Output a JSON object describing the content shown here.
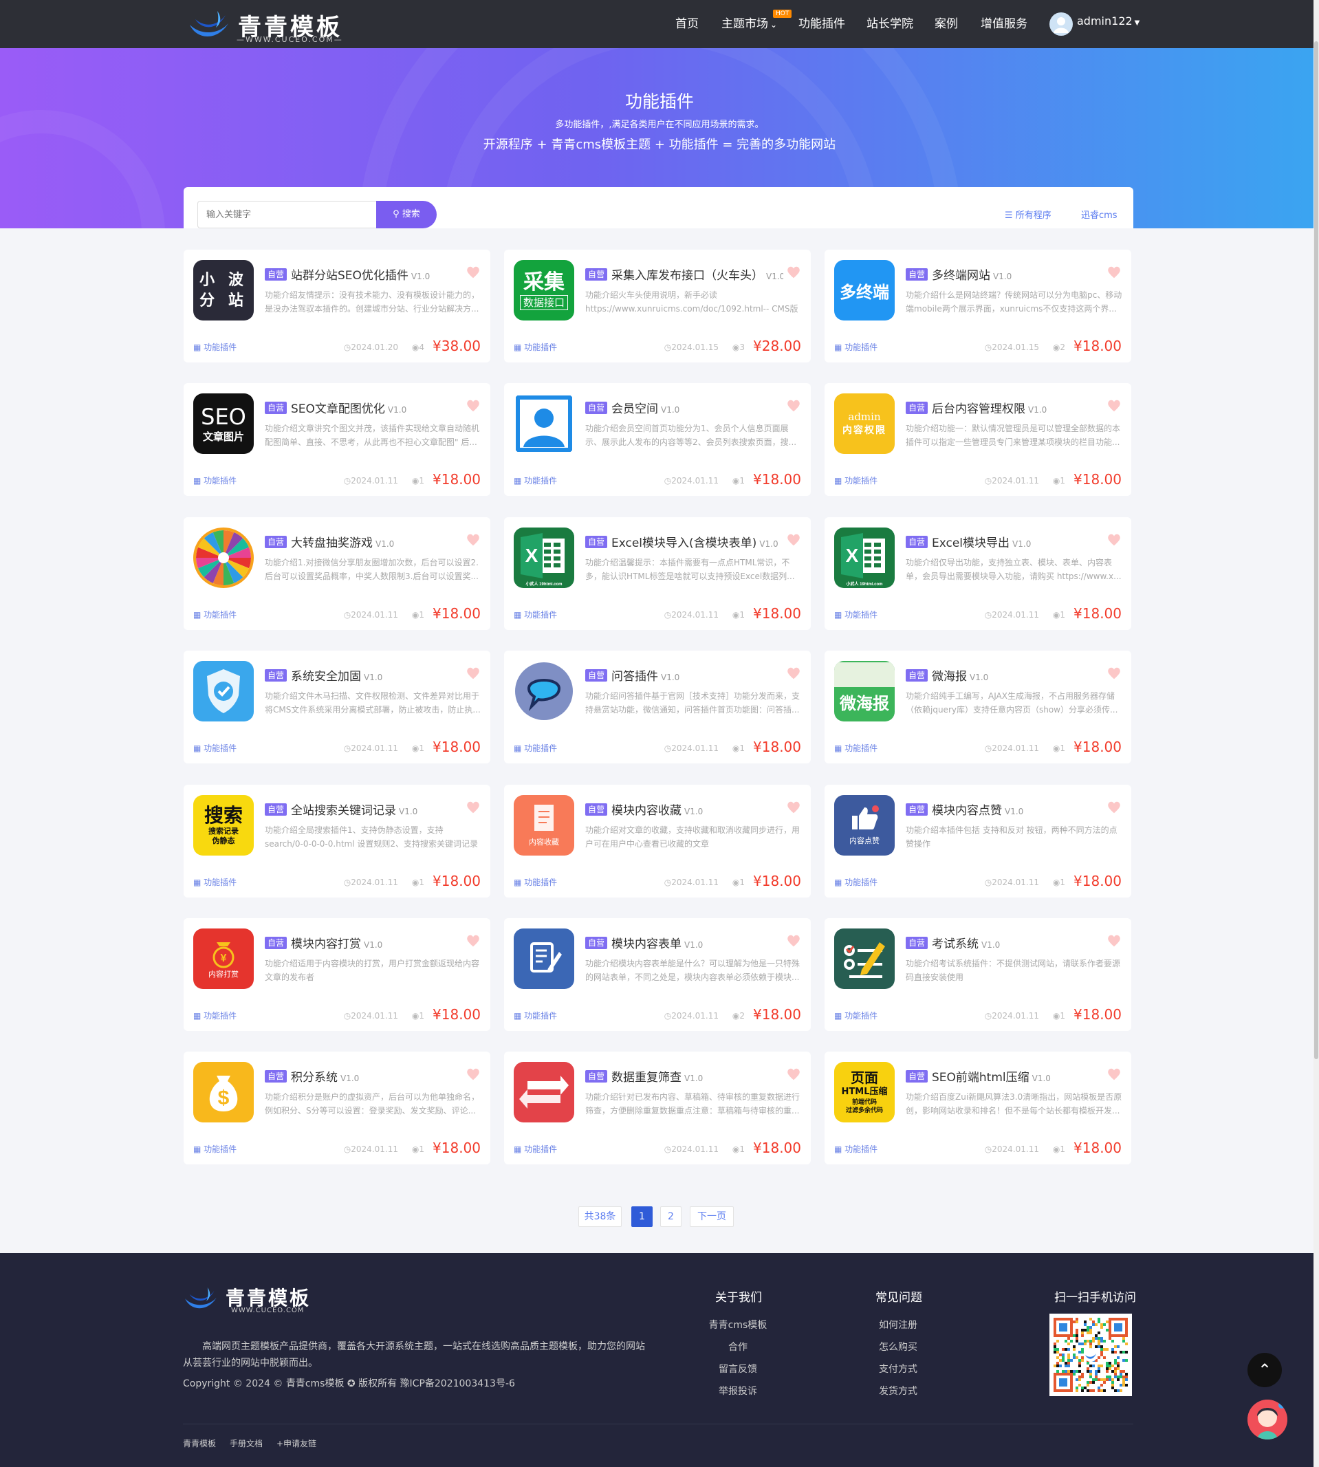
{
  "header": {
    "logo_text": "青青模板",
    "logo_url": "—WWW.CUCEO.COM—",
    "nav": [
      "首页",
      "主题市场",
      "功能插件",
      "站长学院",
      "案例",
      "增值服务"
    ],
    "hot_badge": "HOT",
    "user": "admin122"
  },
  "banner": {
    "title": "功能插件",
    "subtitle": "多功能插件，,满足各类用户在不同应用场景的需求。",
    "tagline": "开源程序 + 青青cms模板主题 + 功能插件 = 完善的多功能网站"
  },
  "search": {
    "placeholder": "输入关键字",
    "button": "搜索",
    "filter_all": "所有程序",
    "filter_cms": "迅睿cms"
  },
  "products": [
    {
      "name": "站群分站SEO优化插件",
      "version": "V1.0",
      "tag": "自营",
      "desc": "功能介绍友情提示：没有技术能力、没有模板设计能力的，是没办法驾驭本插件的。创建城市分站、行业分站解决方...",
      "category": "功能插件",
      "date": "2024.01.20",
      "views": "4",
      "price": "¥38.00",
      "icon": "小波分站",
      "icon_text": [
        "小 波",
        "分 站"
      ],
      "icon_bg": "#2a2a38",
      "icon_fg": "#ffffff"
    },
    {
      "name": "采集入库发布接口（火车头）",
      "version": "V1.0",
      "tag": "自营",
      "desc": "功能介绍火车头使用说明，新手必读 https://www.xunruicms.com/doc/1092.html-- CMS版本说明1、支持迅...",
      "category": "功能插件",
      "date": "2024.01.15",
      "views": "3",
      "price": "¥28.00",
      "icon": "采集数据接口",
      "icon_text": [
        "采集",
        "数据接口"
      ],
      "icon_bg": "#13a33d",
      "icon_fg": "#ffffff"
    },
    {
      "name": "多终端网站",
      "version": "V1.0",
      "tag": "自营",
      "desc": "功能介绍什么是网站终端？传统网站可以分为电脑pc、移动端mobile两个展示界面，xunruicms不仅支持这两个界...",
      "category": "功能插件",
      "date": "2024.01.15",
      "views": "2",
      "price": "¥18.00",
      "icon": "多终端",
      "icon_text": [
        "多终端"
      ],
      "icon_bg": "#2196f3",
      "icon_fg": "#ffffff"
    },
    {
      "name": "SEO文章配图优化",
      "version": "V1.0",
      "tag": "自营",
      "desc": "功能介绍文章讲究个图文并茂，该插件实现给文章自动随机配图简单、直接、不思考，从此再也不担心文章配图\" 后...",
      "category": "功能插件",
      "date": "2024.01.11",
      "views": "1",
      "price": "¥18.00",
      "icon": "SEO文章图片",
      "icon_text": [
        "SEO",
        "文章图片"
      ],
      "icon_bg": "#111111",
      "icon_fg": "#ffffff"
    },
    {
      "name": "会员空间",
      "version": "V1.0",
      "tag": "自营",
      "desc": "功能介绍会员空间首页功能分为1、会员个人信息页面展示、展示此人发布的内容等等2、会员列表搜索页面，搜...",
      "category": "功能插件",
      "date": "2024.01.11",
      "views": "1",
      "price": "¥18.00",
      "icon": "user-icon",
      "icon_text": [],
      "icon_bg": "#ffffff",
      "icon_fg": "#1e8be6"
    },
    {
      "name": "后台内容管理权限",
      "version": "V1.0",
      "tag": "自营",
      "desc": "功能介绍功能一：默认情况管理员是可以管理全部数据的本插件可以指定一些管理员专门来管理某项模块的栏目功能...",
      "category": "功能插件",
      "date": "2024.01.11",
      "views": "1",
      "price": "¥18.00",
      "icon": "admin内容权限",
      "icon_text": [
        "admin",
        "内容权限"
      ],
      "icon_bg": "#f7c21c",
      "icon_fg": "#ffffff"
    },
    {
      "name": "大转盘抽奖游戏",
      "version": "V1.0",
      "tag": "自营",
      "desc": "功能介绍1.对接微信分享朋友圈增加次数，后台可以设置2.后台可以设置奖品概率，中奖人数限制3.后台可以设置奖...",
      "category": "功能插件",
      "date": "2024.01.11",
      "views": "1",
      "price": "¥18.00",
      "icon": "wheel-icon",
      "icon_text": [],
      "icon_bg": "#ffffff",
      "icon_fg": "#ffffff"
    },
    {
      "name": "Excel模块导入(含模块表单)",
      "version": "V1.0",
      "tag": "自营",
      "desc": "功能介绍温馨提示：本插件需要有一点点HTML常识，不多，能认识HTML标签是啥就可以支持预设Excel数据列...",
      "category": "功能插件",
      "date": "2024.01.11",
      "views": "1",
      "price": "¥18.00",
      "icon": "excel-icon",
      "icon_text": [
        "X",
        "小武人 19html.com"
      ],
      "icon_bg": "#1a7b40",
      "icon_fg": "#ffffff"
    },
    {
      "name": "Excel模块导出",
      "version": "V1.0",
      "tag": "自营",
      "desc": "功能介绍仅导出功能，支持独立表、模块、表单、内容表单，会员导出需要模块导入功能，请购买 https://www.x...",
      "category": "功能插件",
      "date": "2024.01.11",
      "views": "1",
      "price": "¥18.00",
      "icon": "excel-icon",
      "icon_text": [
        "X",
        "小武人 19html.com"
      ],
      "icon_bg": "#1a7b40",
      "icon_fg": "#ffffff"
    },
    {
      "name": "系统安全加固",
      "version": "V1.0",
      "tag": "自营",
      "desc": "功能介绍文件木马扫描、文件权限检测、文件差异对比用于将CMS文件系统采用分离模式部署，防止被攻击，防止执...",
      "category": "功能插件",
      "date": "2024.01.11",
      "views": "1",
      "price": "¥18.00",
      "icon": "shield-icon",
      "icon_text": [],
      "icon_bg": "#3aa7ec",
      "icon_fg": "#ffffff"
    },
    {
      "name": "问答插件",
      "version": "V1.0",
      "tag": "自营",
      "desc": "功能介绍问答插件基于官网［技术支持］功能分发而来，支持悬赏站功能，微信通知，问答插件首页功能图：问答插...",
      "category": "功能插件",
      "date": "2024.01.11",
      "views": "1",
      "price": "¥18.00",
      "icon": "chat-icon",
      "icon_text": [],
      "icon_bg": "#ffffff",
      "icon_fg": "#2e4a8c"
    },
    {
      "name": "微海报",
      "version": "V1.0",
      "tag": "自营",
      "desc": "功能介绍纯手工编写，AJAX生成海报，不占用服务器存储（依赖jquery库）支持任意内容页（show）分享必须传...",
      "category": "功能插件",
      "date": "2024.01.11",
      "views": "1",
      "price": "¥18.00",
      "icon": "微海报",
      "icon_text": [
        "微海报"
      ],
      "icon_bg": "#3cb55a",
      "icon_fg": "#ffffff"
    },
    {
      "name": "全站搜索关键词记录",
      "version": "V1.0",
      "tag": "自营",
      "desc": "功能介绍全局搜索插件1、支持伪静态设置，支持 search/0-0-0-0-0.html 设置规则2、支持搜索关键词记录（分...",
      "category": "功能插件",
      "date": "2024.01.11",
      "views": "1",
      "price": "¥18.00",
      "icon": "搜索记录伪静态",
      "icon_text": [
        "搜索",
        "搜索记录",
        "伪静态"
      ],
      "icon_bg": "#f8d90f",
      "icon_fg": "#111111"
    },
    {
      "name": "模块内容收藏",
      "version": "V1.0",
      "tag": "自营",
      "desc": "功能介绍对文章的收藏，支持收藏和取消收藏同步进行，用户可在用户中心查看已收藏的文章",
      "category": "功能插件",
      "date": "2024.01.11",
      "views": "1",
      "price": "¥18.00",
      "icon": "内容收藏",
      "icon_text": [
        "内容收藏"
      ],
      "icon_bg": "#f87a58",
      "icon_fg": "#ffffff"
    },
    {
      "name": "模块内容点赞",
      "version": "V1.0",
      "tag": "自营",
      "desc": "功能介绍本插件包括 支持和反对 按钮，两种不同方法的点赞操作",
      "category": "功能插件",
      "date": "2024.01.11",
      "views": "1",
      "price": "¥18.00",
      "icon": "内容点赞",
      "icon_text": [
        "内容点赞"
      ],
      "icon_bg": "#3d5a9e",
      "icon_fg": "#ffffff"
    },
    {
      "name": "模块内容打赏",
      "version": "V1.0",
      "tag": "自营",
      "desc": "功能介绍适用于内容模块的打赏，用户打赏金额返现给内容文章的发布者",
      "category": "功能插件",
      "date": "2024.01.11",
      "views": "1",
      "price": "¥18.00",
      "icon": "内容打赏",
      "icon_text": [
        "¥",
        "内容打赏"
      ],
      "icon_bg": "#e5342d",
      "icon_fg": "#ffffff"
    },
    {
      "name": "模块内容表单",
      "version": "V1.0",
      "tag": "自营",
      "desc": "功能介绍模块内容表单能是什么？可以理解为他是一只特殊的网站表单，不同之处是，模块内容表单必须依赖于模块...",
      "category": "功能插件",
      "date": "2024.01.11",
      "views": "2",
      "price": "¥18.00",
      "icon": "form-icon",
      "icon_text": [],
      "icon_bg": "#3b67b5",
      "icon_fg": "#ffffff"
    },
    {
      "name": "考试系统",
      "version": "V1.0",
      "tag": "自营",
      "desc": "功能介绍考试系统插件：不提供测试网站，请联系作者要源码直接安装使用",
      "category": "功能插件",
      "date": "2024.01.11",
      "views": "1",
      "price": "¥18.00",
      "icon": "exam-icon",
      "icon_text": [],
      "icon_bg": "#275e52",
      "icon_fg": "#ffffff"
    },
    {
      "name": "积分系统",
      "version": "V1.0",
      "tag": "自营",
      "desc": "功能介绍积分是账户的虚拟资产，后台可以为他单独命名，例如积分、S分等可以设置：登录奖励、发文奖励、评论...",
      "category": "功能插件",
      "date": "2024.01.11",
      "views": "1",
      "price": "¥18.00",
      "icon": "moneybag-icon",
      "icon_text": [
        "$"
      ],
      "icon_bg": "#f8b81c",
      "icon_fg": "#ffffff"
    },
    {
      "name": "数据重复筛查",
      "version": "V1.0",
      "tag": "自营",
      "desc": "功能介绍针对已发布内容、草稿箱、待审核的重复数据进行筛查，方便删除重复数据重点注意：草稿箱与待审核的重...",
      "category": "功能插件",
      "date": "2024.01.11",
      "views": "1",
      "price": "¥18.00",
      "icon": "refresh-icon",
      "icon_text": [],
      "icon_bg": "#e34349",
      "icon_fg": "#ffffff"
    },
    {
      "name": "SEO前端html压缩",
      "version": "V1.0",
      "tag": "自营",
      "desc": "功能介绍百度Zui新飓风算法3.0清晰指出，网站模板是否原创，影响网站收录和排名！但不是每个站长都有模板开发...",
      "category": "功能插件",
      "date": "2024.01.11",
      "views": "1",
      "price": "¥18.00",
      "icon": "页面HTML压缩",
      "icon_text": [
        "页面",
        "HTML压缩",
        "前端代码",
        "过滤多余代码"
      ],
      "icon_bg": "#f8d10f",
      "icon_fg": "#111111"
    }
  ],
  "pagination": {
    "total": "共38条",
    "pages": [
      "1",
      "2"
    ],
    "next": "下一页",
    "current": "1"
  },
  "footer": {
    "logo_text": "青青模板",
    "logo_url": "WWW.CUCEO.COM",
    "about": "高端网页主题模板产品提供商，覆盖各大开源系统主题，一站式在线选购高品质主题模板，助力您的网站从芸芸行业的网站中脱颖而出。",
    "copyright": "Copyright © 2024 © 青青cms模板 ✪ 版权所有 豫ICP备2021003413号-6",
    "col1_title": "关于我们",
    "col1": [
      "青青cms模板",
      "合作",
      "留言反馈",
      "举报投诉"
    ],
    "col2_title": "常见问题",
    "col2": [
      "如何注册",
      "怎么购买",
      "支付方式",
      "发货方式"
    ],
    "qr_title": "扫一扫手机访问",
    "bottom_links": [
      "青青模板",
      "手册文档",
      "+申请友链"
    ]
  },
  "colors": {
    "accent": "#7a5df0",
    "price": "#f23b2b",
    "link": "#5b7cf0",
    "header": "#2d2f36",
    "footer": "#23253a"
  }
}
